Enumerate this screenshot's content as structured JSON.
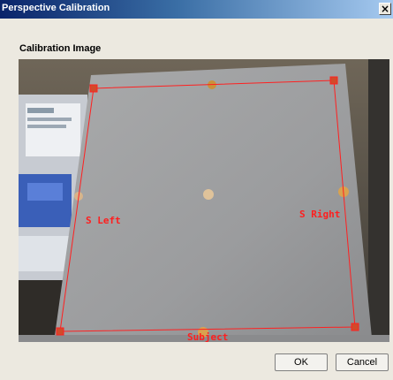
{
  "window": {
    "title": "Perspective Calibration",
    "close_glyph": "×"
  },
  "section": {
    "label": "Calibration Image"
  },
  "calibration": {
    "left_label": "S Left",
    "right_label": "S Right",
    "bottom_label": "Subject",
    "line_color": "#ff2020"
  },
  "buttons": {
    "ok": "OK",
    "cancel": "Cancel"
  },
  "colors": {
    "title_start": "#0a246a",
    "title_end": "#a6caf0",
    "dialog_bg": "#ece9e0"
  }
}
